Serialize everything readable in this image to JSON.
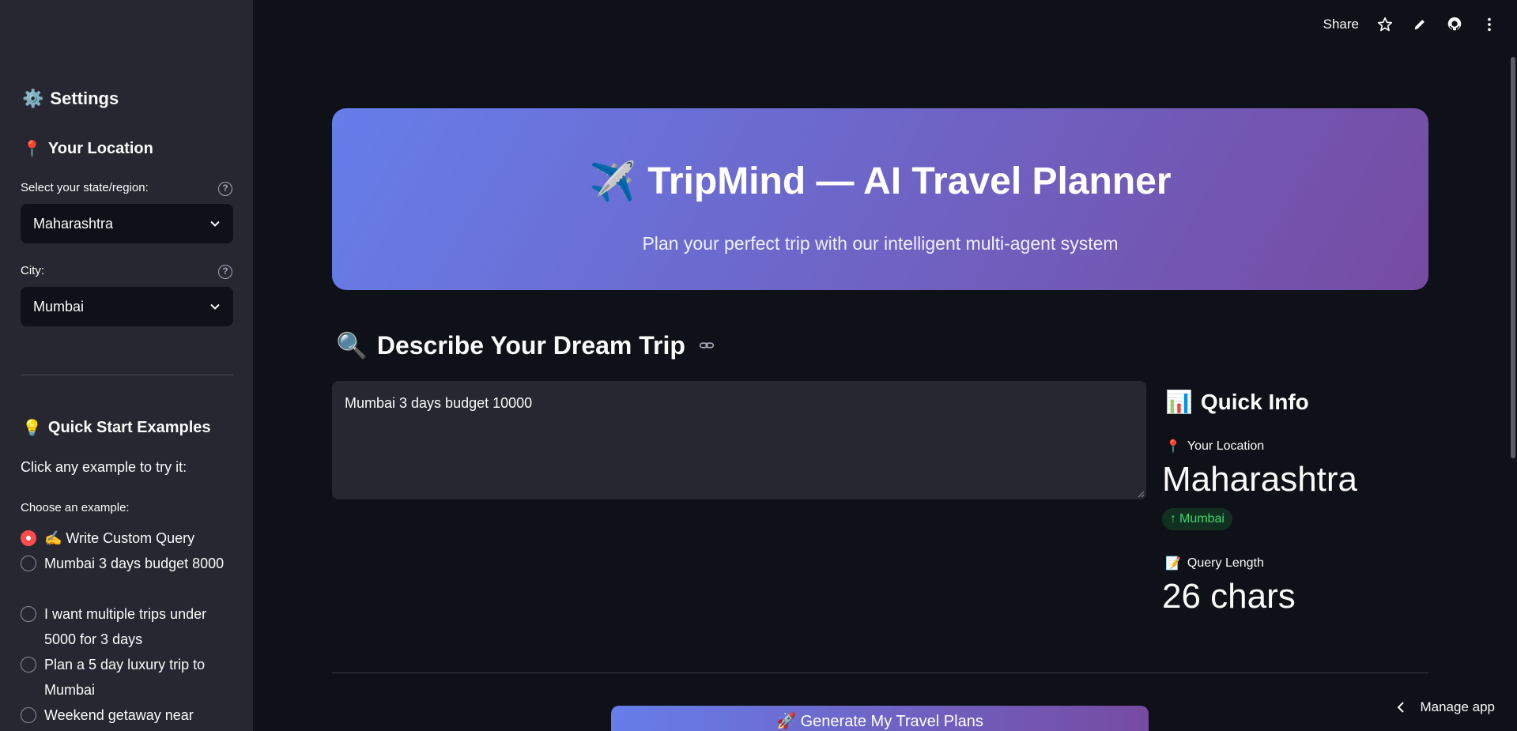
{
  "toolbar": {
    "share_label": "Share",
    "icons": [
      "star-icon",
      "pencil-icon",
      "github-icon",
      "more-vertical-icon"
    ]
  },
  "sidebar": {
    "title_icon": "⚙️",
    "title": "Settings",
    "location_icon": "📍",
    "location_heading": "Your Location",
    "state_label": "Select your state/region:",
    "state_value": "Maharashtra",
    "city_label": "City:",
    "city_value": "Mumbai",
    "examples_icon": "💡",
    "examples_heading": "Quick Start Examples",
    "examples_hint": "Click any example to try it:",
    "choose_label": "Choose an example:",
    "examples": [
      {
        "label": "✍️ Write Custom Query",
        "selected": true
      },
      {
        "label": "Mumbai 3 days budget 8000",
        "selected": false
      },
      {
        "label": "I want multiple trips under 5000 for 3 days",
        "selected": false
      },
      {
        "label": "Plan a 5 day luxury trip to Mumbai",
        "selected": false
      },
      {
        "label": "Weekend getaway near",
        "selected": false
      }
    ]
  },
  "hero": {
    "icon": "✈️",
    "title": "TripMind — AI Travel Planner",
    "subtitle": "Plan your perfect trip with our intelligent multi-agent system"
  },
  "describe": {
    "icon": "🔍",
    "title": "Describe Your Dream Trip",
    "query_value": "Mumbai 3 days budget 10000"
  },
  "quick_info": {
    "icon": "📊",
    "title": "Quick Info",
    "location_icon": "📍",
    "location_label": "Your Location",
    "location_value": "Maharashtra",
    "location_delta": "Mumbai",
    "query_icon": "📝",
    "query_label": "Query Length",
    "query_value": "26 chars"
  },
  "generate_button": "🚀 Generate My Travel Plans",
  "manage_app": "Manage app",
  "colors": {
    "background": "#0e1117",
    "sidebar": "#262730",
    "accent_start": "#667eea",
    "accent_end": "#764ba2",
    "radio_selected": "#ff4b4b",
    "delta_green": "#3dd56d"
  }
}
